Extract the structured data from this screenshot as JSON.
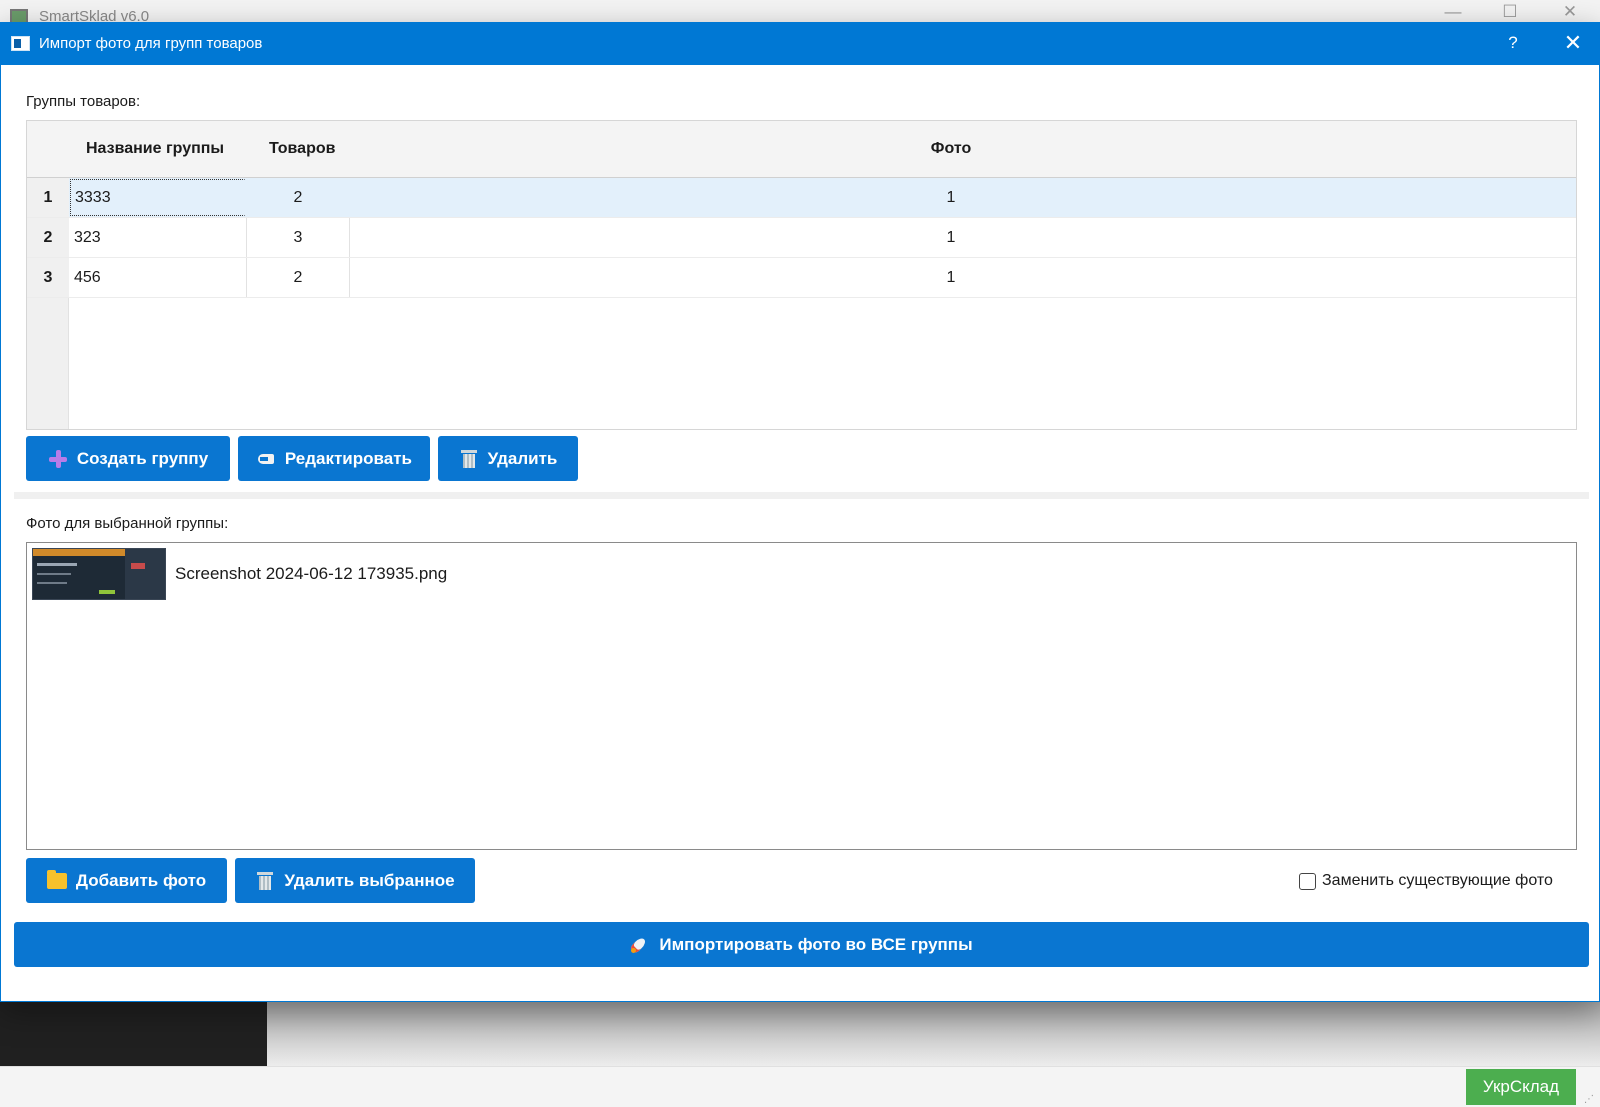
{
  "background_window": {
    "title": "SmartSklad v6.0",
    "min_glyph": "—",
    "max_glyph": "☐",
    "close_glyph": "✕",
    "brand_badge": "УкрСклад",
    "resize_glyph": "⋰"
  },
  "dialog": {
    "title": "Импорт фото для групп товаров",
    "help_glyph": "?",
    "close_glyph": "✕",
    "accent_color": "#0078d4"
  },
  "groups": {
    "section_label": "Группы товаров:",
    "columns": [
      "Название группы",
      "Товаров",
      "Фото"
    ],
    "rows": [
      {
        "index": "1",
        "name": "3333",
        "count": "2",
        "photo": "1",
        "selected": true
      },
      {
        "index": "2",
        "name": "323",
        "count": "3",
        "photo": "1",
        "selected": false
      },
      {
        "index": "3",
        "name": "456",
        "count": "2",
        "photo": "1",
        "selected": false
      }
    ],
    "buttons": {
      "create": "Создать группу",
      "edit": "Редактировать",
      "delete": "Удалить"
    }
  },
  "photos": {
    "section_label": "Фото для выбранной группы:",
    "items": [
      {
        "filename": "Screenshot 2024-06-12 173935.png",
        "thumbnail_icon": "image-thumbnail"
      }
    ],
    "buttons": {
      "add": "Добавить фото",
      "delete_selected": "Удалить выбранное"
    },
    "replace_checkbox": {
      "label": "Заменить существующие фото",
      "checked": false
    }
  },
  "import_button": {
    "label": "Импортировать фото во ВСЕ группы",
    "icon": "rocket-icon"
  },
  "icons": {
    "create": "plus-icon",
    "edit": "pencil-icon",
    "delete": "trash-icon",
    "add_photo": "folder-icon",
    "delete_photo": "trash-icon"
  }
}
